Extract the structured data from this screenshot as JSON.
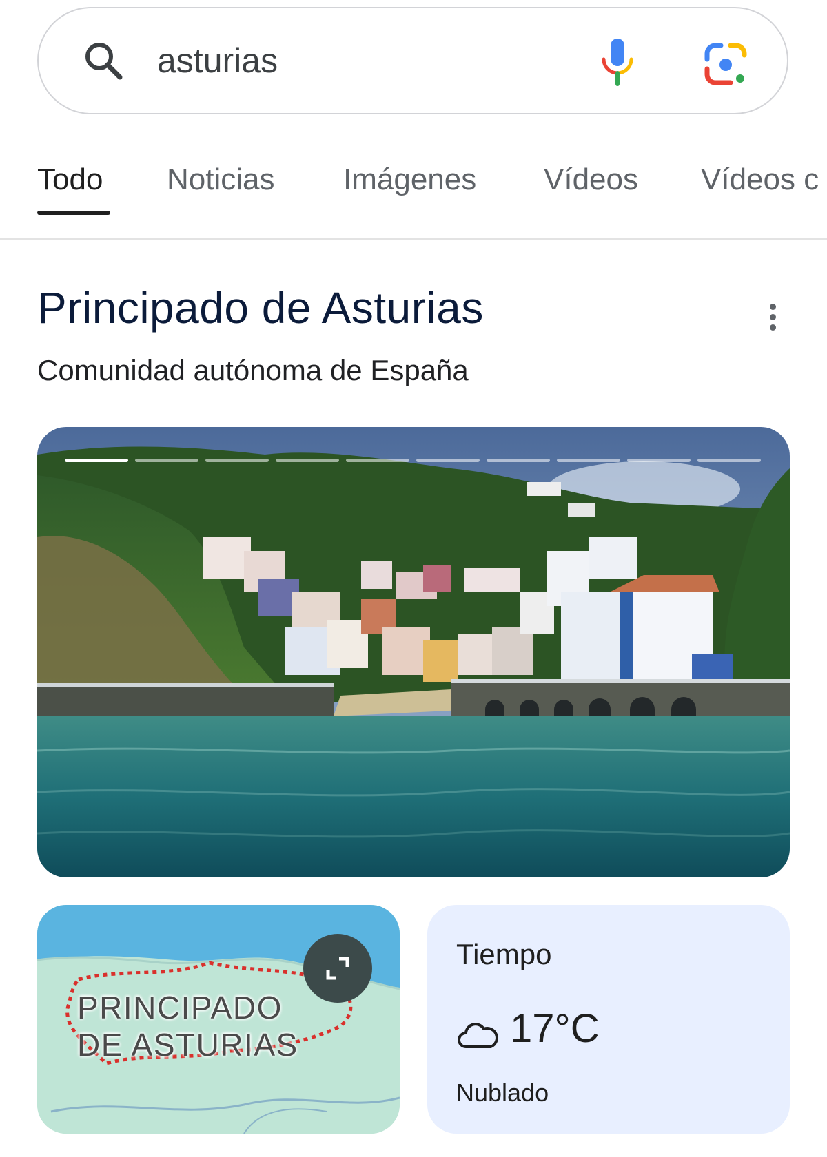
{
  "search": {
    "query": "asturias",
    "icons": [
      "search-icon",
      "mic-icon",
      "google-lens-icon"
    ]
  },
  "tabs": [
    {
      "label": "Todo",
      "active": true
    },
    {
      "label": "Noticias",
      "active": false
    },
    {
      "label": "Imágenes",
      "active": false
    },
    {
      "label": "Vídeos",
      "active": false
    },
    {
      "label": "Vídeos c",
      "active": false
    }
  ],
  "knowledge_panel": {
    "title": "Principado de Asturias",
    "subtitle": "Comunidad autónoma de España",
    "more_icon": "more-vert-icon",
    "carousel": {
      "total_images": 10,
      "current_index": 1
    }
  },
  "map_card": {
    "label_line1": "PRINCIPADO",
    "label_line2": "DE ASTURIAS",
    "expand_icon": "expand-icon"
  },
  "weather_card": {
    "title": "Tiempo",
    "temperature": "17°C",
    "condition": "Nublado",
    "icon": "cloud-icon"
  },
  "colors": {
    "active_tab": "#1f1f1f",
    "inactive_tab": "#5f6368",
    "weather_bg": "#e8efff",
    "map_water": "#5ab4e0",
    "map_land": "#bfe5d6",
    "map_border": "#d9302c"
  }
}
